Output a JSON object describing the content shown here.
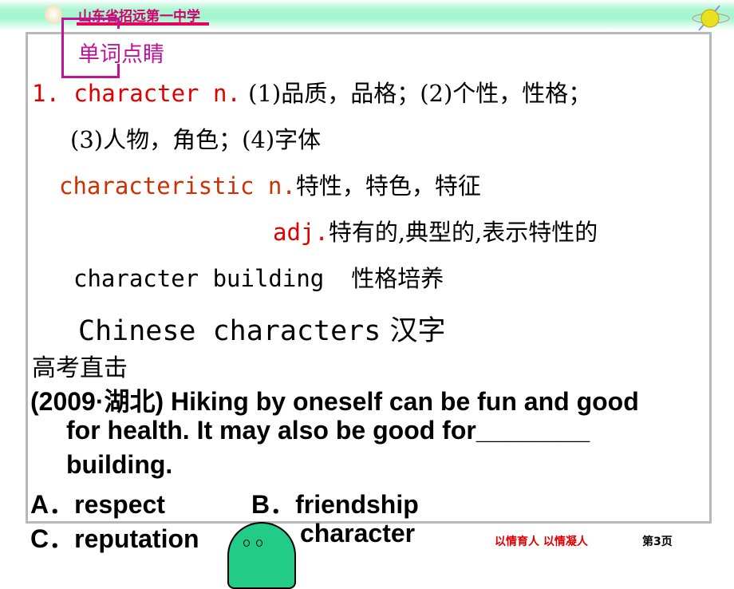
{
  "header": {
    "school": "山东省招远第一中学",
    "section": "单词点睛"
  },
  "entries": {
    "l1_head": "1. character  n.",
    "l1_def": " (1)品质，品格；(2)个性，性格；",
    "l2": "(3)人物，角色；(4)字体",
    "l3_word": "characteristic  n.",
    "l3_def": "特性，特色，特征",
    "l4_pos": "adj.",
    "l4_def": "特有的,典型的,表示特性的",
    "l5_en": "character building",
    "l5_zh": "性格培养",
    "l6_en": "Chinese characters",
    "l6_zh": "汉字"
  },
  "exam": {
    "heading": "高考直击",
    "q1": "(2009·湖北) Hiking by oneself can be fun and good",
    "q2": "for health. It may also be good for________",
    "q3": "building.",
    "a": "A．respect",
    "b": "B．friendship",
    "c": "C．reputation",
    "d": "character"
  },
  "footer": {
    "motto": "以情育人  以情凝人",
    "page": "第3页"
  },
  "colors": {
    "accent": "#c0139a",
    "red": "#e00000",
    "band": "#9ff7cf"
  }
}
